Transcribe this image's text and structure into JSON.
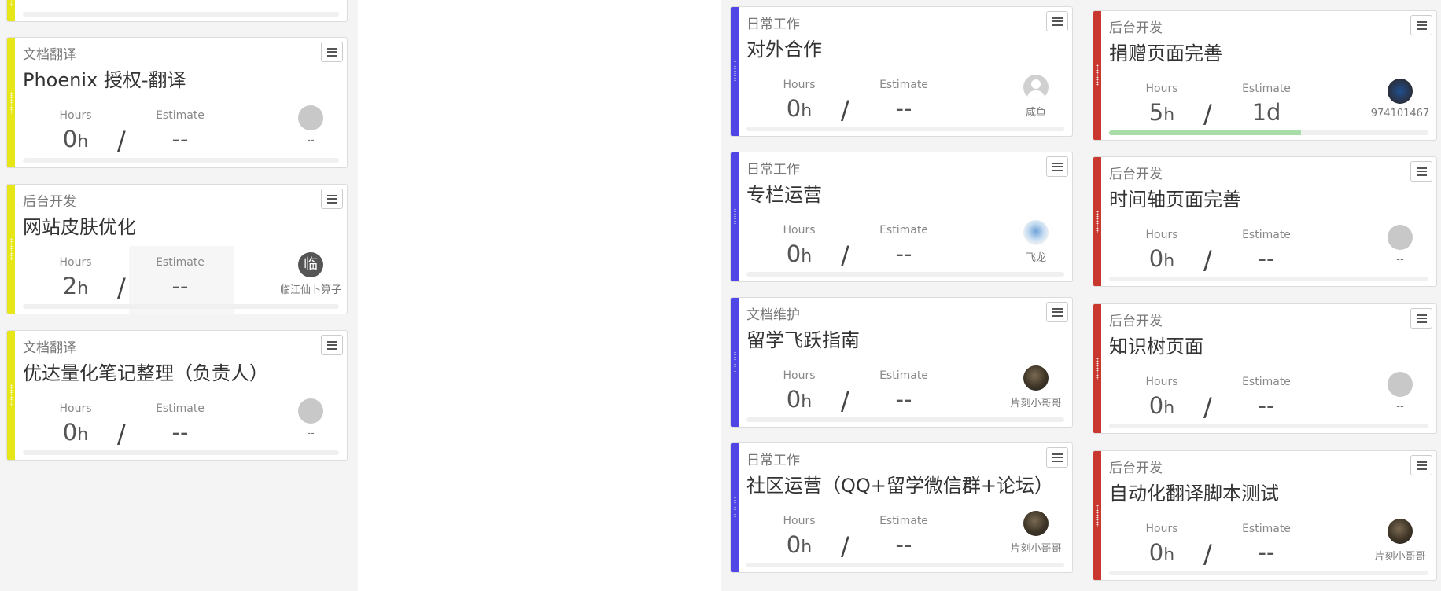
{
  "colors": {
    "yellow": "#e6e619",
    "blue": "#5046e6",
    "red": "#c8382e"
  },
  "left": {
    "cards": [
      {
        "category": "",
        "title": "",
        "hours": "",
        "estimate": "",
        "assignee": ""
      },
      {
        "category": "文档翻译",
        "title": "Phoenix 授权-翻译",
        "hours": "0",
        "estimate": "--",
        "assignee": "--"
      },
      {
        "category": "后台开发",
        "title": "网站皮肤优化",
        "hours": "2",
        "estimate": "--",
        "assignee": "临江仙卜算子",
        "avatar_char": "临"
      },
      {
        "category": "文档翻译",
        "title": "优达量化笔记整理（负责人）",
        "hours": "0",
        "estimate": "--",
        "assignee": "--"
      }
    ]
  },
  "middle": {
    "cards": [
      {
        "category": "日常工作",
        "title": "对外合作",
        "hours": "0",
        "estimate": "--",
        "assignee": "咸鱼"
      },
      {
        "category": "日常工作",
        "title": "专栏运营",
        "hours": "0",
        "estimate": "--",
        "assignee": "飞龙"
      },
      {
        "category": "文档维护",
        "title": "留学飞跃指南",
        "hours": "0",
        "estimate": "--",
        "assignee": "片刻小哥哥"
      },
      {
        "category": "日常工作",
        "title": "社区运营（QQ+留学微信群+论坛）",
        "hours": "0",
        "estimate": "--",
        "assignee": "片刻小哥哥"
      }
    ]
  },
  "right": {
    "cards": [
      {
        "category": "后台开发",
        "title": "捐赠页面完善",
        "hours": "5",
        "estimate": "1d",
        "assignee": "974101467",
        "progress": 0.6
      },
      {
        "category": "后台开发",
        "title": "时间轴页面完善",
        "hours": "0",
        "estimate": "--",
        "assignee": "--"
      },
      {
        "category": "后台开发",
        "title": "知识树页面",
        "hours": "0",
        "estimate": "--",
        "assignee": "--"
      },
      {
        "category": "后台开发",
        "title": "自动化翻译脚本测试",
        "hours": "0",
        "estimate": "--",
        "assignee": "片刻小哥哥"
      }
    ]
  },
  "labels": {
    "hours": "Hours",
    "estimate": "Estimate",
    "hours_unit": "h",
    "slash": "/"
  }
}
